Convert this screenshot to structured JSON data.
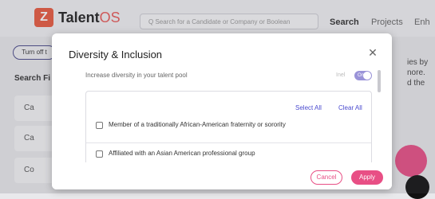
{
  "app": {
    "brand_prefix": "Talent",
    "brand_suffix": "OS",
    "logo_letter": "Z",
    "search_placeholder": "Q  Search for a Candidate or Company or Boolean",
    "nav": [
      "Search",
      "Projects",
      "Enh"
    ],
    "turn_off": "Turn off t",
    "search_filters": "Search Fi",
    "side_cards": [
      "Ca",
      "Ca",
      "Co"
    ],
    "right_text": [
      "ies by",
      "nore.",
      "d the"
    ]
  },
  "modal": {
    "title": "Diversity & Inclusion",
    "close_icon": "close-icon",
    "subtitle": "Increase diversity in your talent pool",
    "toggle_off_label": "Inel",
    "toggle_on_label": "On",
    "select_all": "Select All",
    "clear_all": "Clear All",
    "items": [
      {
        "label": "Member of a traditionally African-American fraternity or sorority",
        "checked": false
      },
      {
        "label": "Affiliated with an Asian American professional group",
        "checked": false
      }
    ],
    "cancel": "Cancel",
    "apply": "Apply"
  },
  "colors": {
    "accent_pink": "#e84f85",
    "link_blue": "#4b4bcf",
    "toggle_purple": "#9a93d8",
    "logo_orange": "#e8593f"
  }
}
